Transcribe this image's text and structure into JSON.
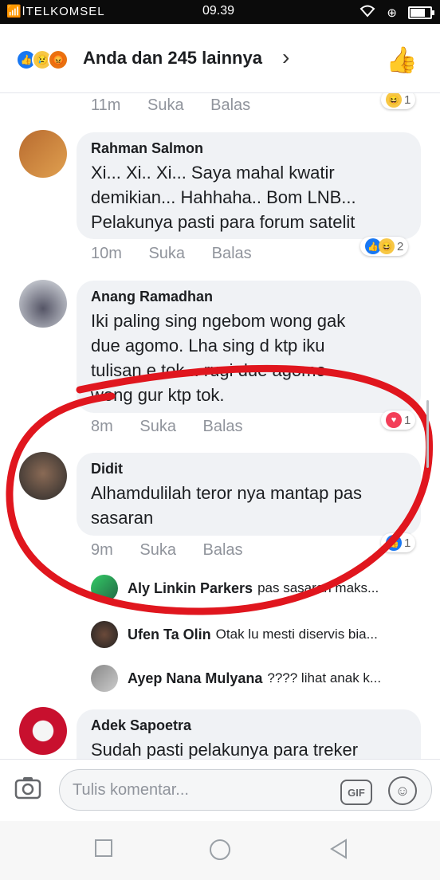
{
  "statusbar": {
    "carrier": "📶ǀTELKOMSEL",
    "time": "09.39",
    "battery_level": 0.8
  },
  "header": {
    "summary": "Anda dan 245 lainnya",
    "reactions": [
      "like-icon",
      "sad-icon",
      "angry-icon"
    ]
  },
  "actions": {
    "like": "Suka",
    "reply": "Balas"
  },
  "comments": [
    {
      "time": "11m",
      "reaction_count": "1",
      "reaction_icons": [
        "haha-icon"
      ]
    },
    {
      "name": "Rahman Salmon",
      "lines": [
        "Xi... Xi.. Xi... Saya mahal kwatir",
        "demikian... Hahhaha.. Bom LNB...",
        "Pelakunya pasti para forum satelit"
      ],
      "time": "10m",
      "reaction_count": "2",
      "reaction_icons": [
        "like-icon",
        "haha-icon"
      ]
    },
    {
      "name": "Anang Ramadhan",
      "lines": [
        "Iki paling sing ngebom wong gak",
        "due agomo. Lha sing d ktp iku",
        "tulisan e tok... rugi due agomo",
        "wong gur ktp tok."
      ],
      "time": "8m",
      "reaction_count": "1",
      "reaction_icons": [
        "love-icon"
      ]
    },
    {
      "name": "Didit",
      "lines": [
        "Alhamdulilah teror nya mantap pas",
        "sasaran"
      ],
      "time": "9m",
      "reaction_count": "1",
      "reaction_icons": [
        "like-icon"
      ]
    },
    {
      "name": "Adek Sapoetra",
      "lines": [
        "Sudah pasti pelakunya para treker"
      ]
    }
  ],
  "replies": [
    {
      "name": "Aly Linkin Parkers",
      "text": "pas sasaran maks..."
    },
    {
      "name": "Ufen Ta Olin",
      "text": "Otak lu mesti diservis bia..."
    },
    {
      "name": "Ayep Nana Mulyana",
      "text": "???? lihat anak k..."
    }
  ],
  "composer": {
    "placeholder": "Tulis komentar...",
    "gif": "GIF"
  },
  "colors": {
    "accent": "#1877f2",
    "annotation": "#e0161e"
  }
}
